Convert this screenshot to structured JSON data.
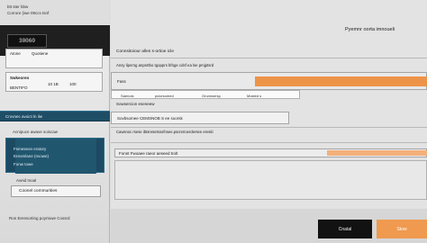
{
  "sidebar": {
    "top_lines": [
      "btt ster bbw",
      "Corrore (iwe 09ccs tsnf"
    ],
    "thumbnail_text": "30060",
    "card1": {
      "title": "Atone",
      "subtitle": "Quotiene"
    },
    "card2": {
      "title": "Swkeoren",
      "cols": [
        "10 1B",
        "100"
      ],
      "line2": "BENTIFO"
    },
    "blue_bar_text": "Crovnec avuict ln  ilw",
    "section_label": "Acnipuce awave soiscaw",
    "panel_line1": "Fsmeseon eratory",
    "panel_line2": "Ereomlane (nvowe)",
    "panel_line3": "Fonw towe",
    "field_label": "Aveid Inoal",
    "button_label": "Coonel commurities",
    "footer_text": "Ron Eeresorting poyrtowe Cossrd"
  },
  "main": {
    "header_title": "Pyemnr oorta imnoueli",
    "section_title": "Connsitoiour alles s-ortioe icle",
    "description": "Ansy lipvrng anpsrtbo tgopprs bfnge cdsf ea lse pmjptsrd",
    "row1_label": "Fass",
    "columns": [
      "Saenotc",
      "pclorsomed",
      "Orunnsersp",
      "Mosted s"
    ],
    "section2_title": "Sowsercion eseneew",
    "row2_text": "Sovbsomee CEMSNOB S ee soorsk",
    "note": "Cawsnoc rsese ibtsresetsnofnsee.pscrerioerdersee eresiti",
    "selected_label": "Fonnt Fwoaee raeor aeseed trolt"
  },
  "footer": {
    "primary_button": "Cnatal",
    "secondary_button": "Stow"
  },
  "colors": {
    "accent": "#ee9448",
    "dark": "#121212",
    "blue": "#1e4d66"
  }
}
